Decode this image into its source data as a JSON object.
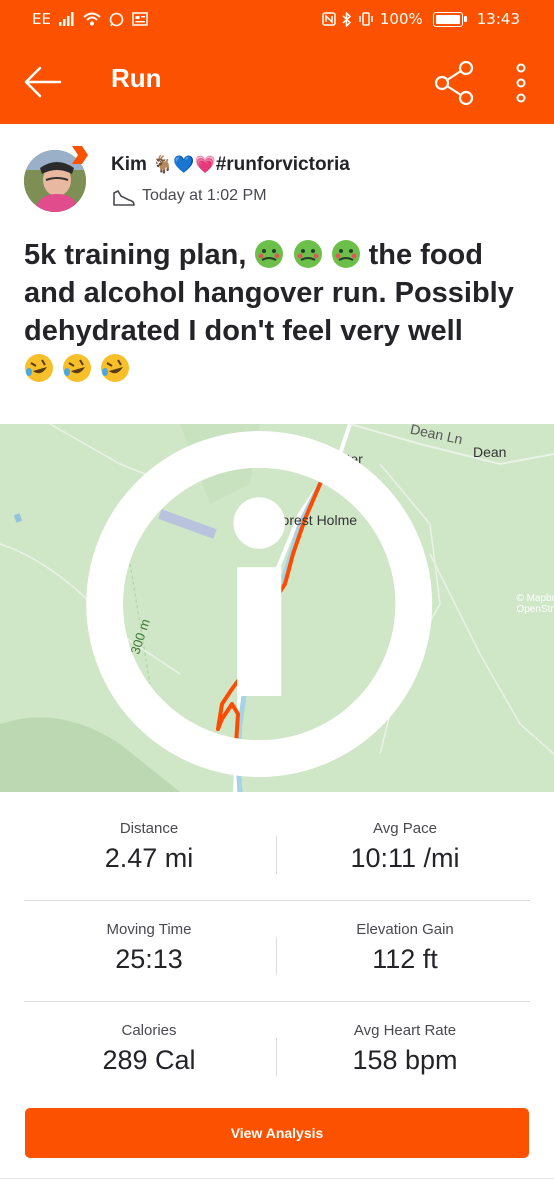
{
  "status_bar": {
    "carrier": "EE",
    "battery": "100%",
    "time": "13:43"
  },
  "app_bar": {
    "title": "Run",
    "back_icon": "arrow-left-icon",
    "share_icon": "share-icon",
    "more_icon": "more-vertical-icon"
  },
  "athlete": {
    "name": "Kim",
    "name_emojis": "🐐💙💗",
    "hashtag": "#runforvictoria",
    "timestamp": "Today at 1:02 PM"
  },
  "activity": {
    "title_part1": "5k training plan,",
    "title_part2": "the food and alcohol hangover run. Possibly dehydrated I don't feel very well"
  },
  "map": {
    "labels": {
      "dean_ln": "Dean Ln",
      "dean": "Dean",
      "water": "Water",
      "forest_holme": "Forest Holme",
      "contour": "300 m"
    },
    "attribution": "© Mapbox © OpenStreetMap"
  },
  "stats": [
    {
      "label": "Distance",
      "value": "2.47 mi"
    },
    {
      "label": "Avg Pace",
      "value": "10:11 /mi"
    },
    {
      "label": "Moving Time",
      "value": "25:13"
    },
    {
      "label": "Elevation Gain",
      "value": "112 ft"
    },
    {
      "label": "Calories",
      "value": "289 Cal"
    },
    {
      "label": "Avg Heart Rate",
      "value": "158 bpm"
    }
  ],
  "actions": {
    "view_analysis": "View Analysis"
  },
  "colors": {
    "brand": "#fc5200",
    "route": "#fc4c02",
    "map_bg": "#cfe7c7"
  }
}
